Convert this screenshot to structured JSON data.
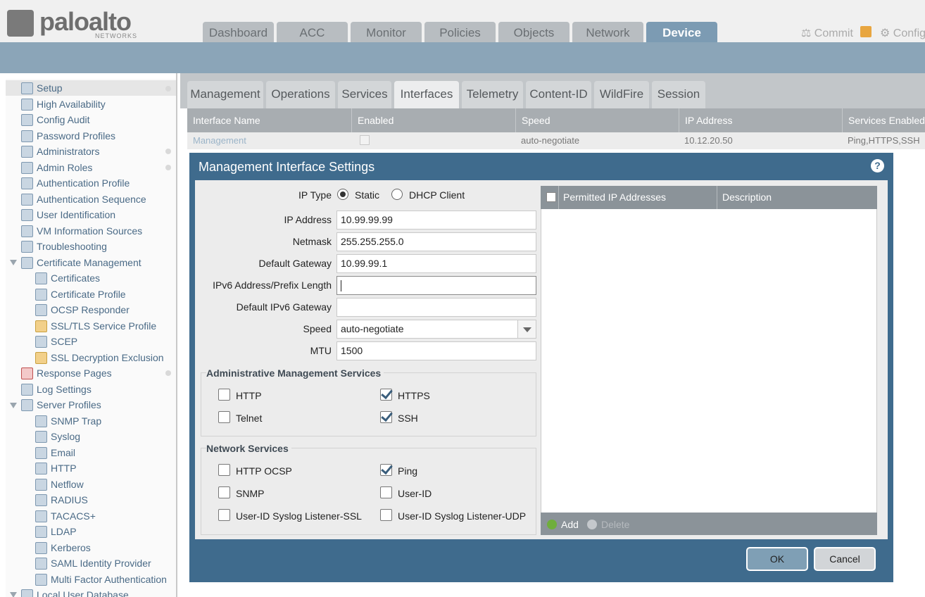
{
  "brand": {
    "name": "paloalto",
    "sub": "NETWORKS"
  },
  "main_tabs": [
    {
      "label": "Dashboard"
    },
    {
      "label": "ACC"
    },
    {
      "label": "Monitor"
    },
    {
      "label": "Policies"
    },
    {
      "label": "Objects"
    },
    {
      "label": "Network"
    },
    {
      "label": "Device",
      "active": true
    }
  ],
  "topright": {
    "commit": "Commit",
    "config": "Config"
  },
  "sidebar": {
    "items": [
      {
        "label": "Setup",
        "icon": "setup-icon"
      },
      {
        "label": "High Availability",
        "icon": "ha-icon"
      },
      {
        "label": "Config Audit",
        "icon": "audit-icon"
      },
      {
        "label": "Password Profiles",
        "icon": "password-icon"
      },
      {
        "label": "Administrators",
        "icon": "admin-icon"
      },
      {
        "label": "Admin Roles",
        "icon": "roles-icon"
      },
      {
        "label": "Authentication Profile",
        "icon": "auth-profile-icon"
      },
      {
        "label": "Authentication Sequence",
        "icon": "auth-seq-icon"
      },
      {
        "label": "User Identification",
        "icon": "user-id-icon"
      },
      {
        "label": "VM Information Sources",
        "icon": "vm-icon"
      },
      {
        "label": "Troubleshooting",
        "icon": "tools-icon"
      },
      {
        "label": "Certificate Management",
        "icon": "cert-mgmt-icon"
      },
      {
        "label": "Certificates",
        "icon": "cert-icon"
      },
      {
        "label": "Certificate Profile",
        "icon": "cert-profile-icon"
      },
      {
        "label": "OCSP Responder",
        "icon": "ocsp-icon"
      },
      {
        "label": "SSL/TLS Service Profile",
        "icon": "lock-icon"
      },
      {
        "label": "SCEP",
        "icon": "scep-icon"
      },
      {
        "label": "SSL Decryption Exclusion",
        "icon": "lock-icon"
      },
      {
        "label": "Response Pages",
        "icon": "response-icon"
      },
      {
        "label": "Log Settings",
        "icon": "log-icon"
      },
      {
        "label": "Server Profiles",
        "icon": "server-icon"
      },
      {
        "label": "SNMP Trap",
        "icon": "doc-icon"
      },
      {
        "label": "Syslog",
        "icon": "doc-icon"
      },
      {
        "label": "Email",
        "icon": "email-icon"
      },
      {
        "label": "HTTP",
        "icon": "doc-icon"
      },
      {
        "label": "Netflow",
        "icon": "doc-icon"
      },
      {
        "label": "RADIUS",
        "icon": "radius-icon"
      },
      {
        "label": "TACACS+",
        "icon": "radius-icon"
      },
      {
        "label": "LDAP",
        "icon": "radius-icon"
      },
      {
        "label": "Kerberos",
        "icon": "radius-icon"
      },
      {
        "label": "SAML Identity Provider",
        "icon": "radius-icon"
      },
      {
        "label": "Multi Factor Authentication",
        "icon": "doc-icon"
      },
      {
        "label": "Local User Database",
        "icon": "db-icon"
      }
    ]
  },
  "sub_tabs": [
    {
      "label": "Management"
    },
    {
      "label": "Operations"
    },
    {
      "label": "Services"
    },
    {
      "label": "Interfaces",
      "active": true
    },
    {
      "label": "Telemetry"
    },
    {
      "label": "Content-ID"
    },
    {
      "label": "WildFire"
    },
    {
      "label": "Session"
    }
  ],
  "table": {
    "headers": [
      "Interface Name",
      "Enabled",
      "Speed",
      "IP Address",
      "Services Enabled"
    ],
    "row": {
      "name": "Management",
      "speed": "auto-negotiate",
      "ip": "10.12.20.50",
      "services": "Ping,HTTPS,SSH"
    }
  },
  "dialog": {
    "title": "Management Interface Settings",
    "ip_type_label": "IP Type",
    "ip_type_static": "Static",
    "ip_type_dhcp": "DHCP Client",
    "ip_address_label": "IP Address",
    "ip_address": "10.99.99.99",
    "netmask_label": "Netmask",
    "netmask": "255.255.255.0",
    "gateway_label": "Default Gateway",
    "gateway": "10.99.99.1",
    "ipv6_label": "IPv6 Address/Prefix Length",
    "ipv6": "",
    "ipv6_gw_label": "Default IPv6 Gateway",
    "ipv6_gw": "",
    "speed_label": "Speed",
    "speed": "auto-negotiate",
    "mtu_label": "MTU",
    "mtu": "1500",
    "admin_services_title": "Administrative Management Services",
    "admin_services": [
      {
        "label": "HTTP",
        "checked": false
      },
      {
        "label": "HTTPS",
        "checked": true
      },
      {
        "label": "Telnet",
        "checked": false
      },
      {
        "label": "SSH",
        "checked": true
      }
    ],
    "network_services_title": "Network Services",
    "network_services": [
      {
        "label": "HTTP OCSP",
        "checked": false
      },
      {
        "label": "Ping",
        "checked": true
      },
      {
        "label": "SNMP",
        "checked": false
      },
      {
        "label": "User-ID",
        "checked": false
      },
      {
        "label": "User-ID Syslog Listener-SSL",
        "checked": false
      },
      {
        "label": "User-ID Syslog Listener-UDP",
        "checked": false
      }
    ],
    "permitted_header": "Permitted IP Addresses",
    "description_header": "Description",
    "add_label": "Add",
    "delete_label": "Delete",
    "ok_label": "OK",
    "cancel_label": "Cancel"
  }
}
